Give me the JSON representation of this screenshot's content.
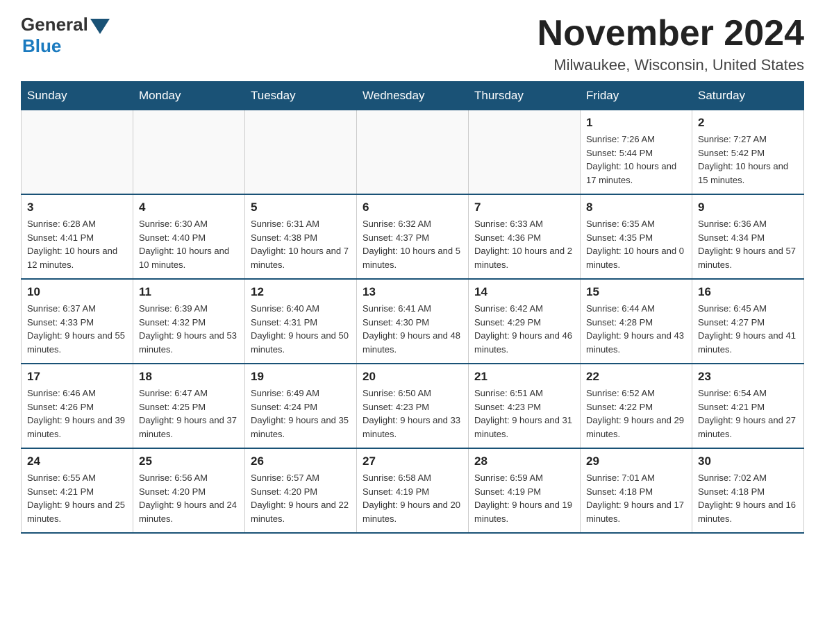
{
  "header": {
    "logo_general": "General",
    "logo_blue": "Blue",
    "month_title": "November 2024",
    "location": "Milwaukee, Wisconsin, United States"
  },
  "weekdays": [
    "Sunday",
    "Monday",
    "Tuesday",
    "Wednesday",
    "Thursday",
    "Friday",
    "Saturday"
  ],
  "weeks": [
    [
      {
        "day": "",
        "info": ""
      },
      {
        "day": "",
        "info": ""
      },
      {
        "day": "",
        "info": ""
      },
      {
        "day": "",
        "info": ""
      },
      {
        "day": "",
        "info": ""
      },
      {
        "day": "1",
        "info": "Sunrise: 7:26 AM\nSunset: 5:44 PM\nDaylight: 10 hours\nand 17 minutes."
      },
      {
        "day": "2",
        "info": "Sunrise: 7:27 AM\nSunset: 5:42 PM\nDaylight: 10 hours\nand 15 minutes."
      }
    ],
    [
      {
        "day": "3",
        "info": "Sunrise: 6:28 AM\nSunset: 4:41 PM\nDaylight: 10 hours\nand 12 minutes."
      },
      {
        "day": "4",
        "info": "Sunrise: 6:30 AM\nSunset: 4:40 PM\nDaylight: 10 hours\nand 10 minutes."
      },
      {
        "day": "5",
        "info": "Sunrise: 6:31 AM\nSunset: 4:38 PM\nDaylight: 10 hours\nand 7 minutes."
      },
      {
        "day": "6",
        "info": "Sunrise: 6:32 AM\nSunset: 4:37 PM\nDaylight: 10 hours\nand 5 minutes."
      },
      {
        "day": "7",
        "info": "Sunrise: 6:33 AM\nSunset: 4:36 PM\nDaylight: 10 hours\nand 2 minutes."
      },
      {
        "day": "8",
        "info": "Sunrise: 6:35 AM\nSunset: 4:35 PM\nDaylight: 10 hours\nand 0 minutes."
      },
      {
        "day": "9",
        "info": "Sunrise: 6:36 AM\nSunset: 4:34 PM\nDaylight: 9 hours\nand 57 minutes."
      }
    ],
    [
      {
        "day": "10",
        "info": "Sunrise: 6:37 AM\nSunset: 4:33 PM\nDaylight: 9 hours\nand 55 minutes."
      },
      {
        "day": "11",
        "info": "Sunrise: 6:39 AM\nSunset: 4:32 PM\nDaylight: 9 hours\nand 53 minutes."
      },
      {
        "day": "12",
        "info": "Sunrise: 6:40 AM\nSunset: 4:31 PM\nDaylight: 9 hours\nand 50 minutes."
      },
      {
        "day": "13",
        "info": "Sunrise: 6:41 AM\nSunset: 4:30 PM\nDaylight: 9 hours\nand 48 minutes."
      },
      {
        "day": "14",
        "info": "Sunrise: 6:42 AM\nSunset: 4:29 PM\nDaylight: 9 hours\nand 46 minutes."
      },
      {
        "day": "15",
        "info": "Sunrise: 6:44 AM\nSunset: 4:28 PM\nDaylight: 9 hours\nand 43 minutes."
      },
      {
        "day": "16",
        "info": "Sunrise: 6:45 AM\nSunset: 4:27 PM\nDaylight: 9 hours\nand 41 minutes."
      }
    ],
    [
      {
        "day": "17",
        "info": "Sunrise: 6:46 AM\nSunset: 4:26 PM\nDaylight: 9 hours\nand 39 minutes."
      },
      {
        "day": "18",
        "info": "Sunrise: 6:47 AM\nSunset: 4:25 PM\nDaylight: 9 hours\nand 37 minutes."
      },
      {
        "day": "19",
        "info": "Sunrise: 6:49 AM\nSunset: 4:24 PM\nDaylight: 9 hours\nand 35 minutes."
      },
      {
        "day": "20",
        "info": "Sunrise: 6:50 AM\nSunset: 4:23 PM\nDaylight: 9 hours\nand 33 minutes."
      },
      {
        "day": "21",
        "info": "Sunrise: 6:51 AM\nSunset: 4:23 PM\nDaylight: 9 hours\nand 31 minutes."
      },
      {
        "day": "22",
        "info": "Sunrise: 6:52 AM\nSunset: 4:22 PM\nDaylight: 9 hours\nand 29 minutes."
      },
      {
        "day": "23",
        "info": "Sunrise: 6:54 AM\nSunset: 4:21 PM\nDaylight: 9 hours\nand 27 minutes."
      }
    ],
    [
      {
        "day": "24",
        "info": "Sunrise: 6:55 AM\nSunset: 4:21 PM\nDaylight: 9 hours\nand 25 minutes."
      },
      {
        "day": "25",
        "info": "Sunrise: 6:56 AM\nSunset: 4:20 PM\nDaylight: 9 hours\nand 24 minutes."
      },
      {
        "day": "26",
        "info": "Sunrise: 6:57 AM\nSunset: 4:20 PM\nDaylight: 9 hours\nand 22 minutes."
      },
      {
        "day": "27",
        "info": "Sunrise: 6:58 AM\nSunset: 4:19 PM\nDaylight: 9 hours\nand 20 minutes."
      },
      {
        "day": "28",
        "info": "Sunrise: 6:59 AM\nSunset: 4:19 PM\nDaylight: 9 hours\nand 19 minutes."
      },
      {
        "day": "29",
        "info": "Sunrise: 7:01 AM\nSunset: 4:18 PM\nDaylight: 9 hours\nand 17 minutes."
      },
      {
        "day": "30",
        "info": "Sunrise: 7:02 AM\nSunset: 4:18 PM\nDaylight: 9 hours\nand 16 minutes."
      }
    ]
  ]
}
